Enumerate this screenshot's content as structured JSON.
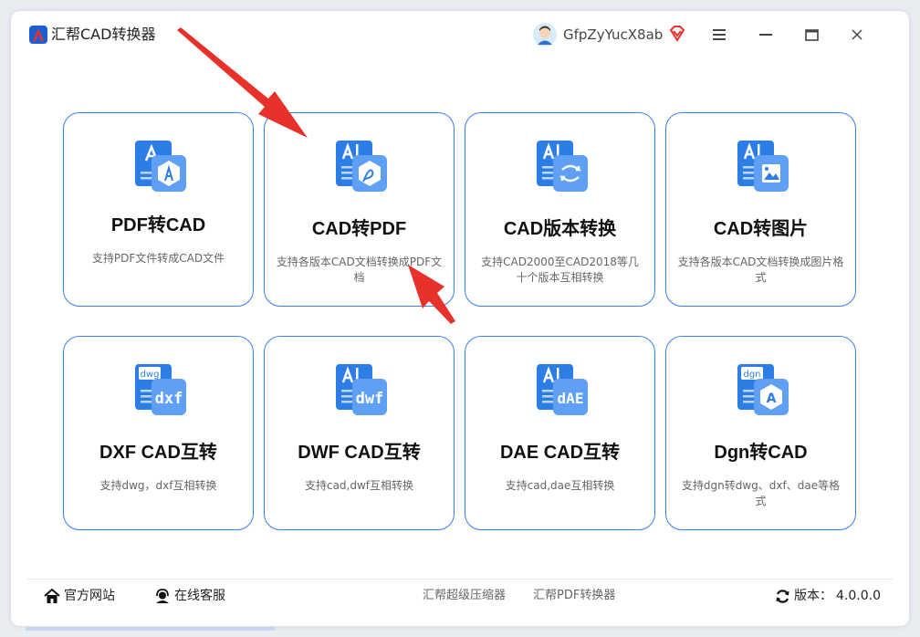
{
  "app": {
    "title": "汇帮CAD转换器"
  },
  "user": {
    "name": "GfpZyYucX8ab"
  },
  "colors": {
    "accent": "#3a7ff0",
    "icon_blue": "#2d7de6",
    "arrow": "#e8312b"
  },
  "cards": [
    {
      "title": "PDF转CAD",
      "desc": "支持PDF文件转成CAD文件",
      "icon": "pdf-to-cad-icon"
    },
    {
      "title": "CAD转PDF",
      "desc": "支持各版本CAD文档转换成PDF文档",
      "icon": "cad-to-pdf-icon"
    },
    {
      "title": "CAD版本转换",
      "desc": "支持CAD2000至CAD2018等几十个版本互相转换",
      "icon": "cad-version-icon"
    },
    {
      "title": "CAD转图片",
      "desc": "支持各版本CAD文档转换成图片格式",
      "icon": "cad-to-image-icon"
    },
    {
      "title": "DXF CAD互转",
      "desc": "支持dwg，dxf互相转换",
      "icon": "dxf-icon",
      "badge": "dxf",
      "top_tag": "dwg"
    },
    {
      "title": "DWF CAD互转",
      "desc": "支持cad,dwf互相转换",
      "icon": "dwf-icon",
      "badge": "dwf"
    },
    {
      "title": "DAE CAD互转",
      "desc": "支持cad,dae互相转换",
      "icon": "dae-icon",
      "badge": "dAE"
    },
    {
      "title": "Dgn转CAD",
      "desc": "支持dgn转dwg、dxf、dae等格式",
      "icon": "dgn-icon",
      "badge": "A",
      "top_tag": "dgn"
    }
  ],
  "footer": {
    "website": "官方网站",
    "service": "在线客服",
    "link1": "汇帮超级压缩器",
    "link2": "汇帮PDF转换器",
    "version_label": "版本：",
    "version": "4.0.0.0"
  }
}
